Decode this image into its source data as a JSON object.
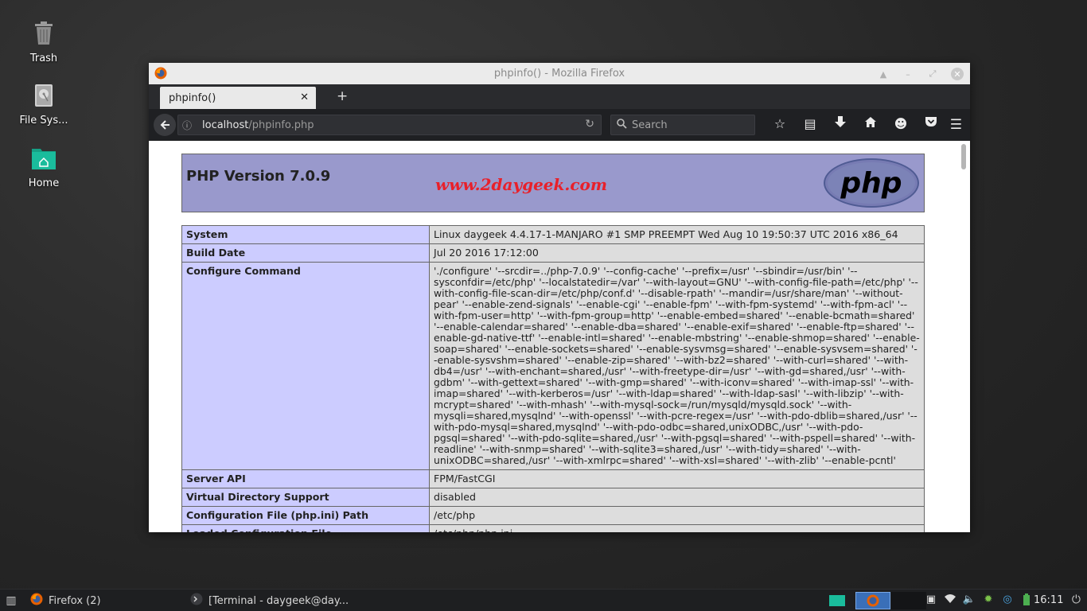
{
  "desktop": {
    "icons": [
      {
        "label": "Trash"
      },
      {
        "label": "File Sys..."
      },
      {
        "label": "Home"
      }
    ]
  },
  "window": {
    "title": "phpinfo() - Mozilla Firefox"
  },
  "browser": {
    "tab_title": "phpinfo()",
    "url_host": "localhost",
    "url_path": "/phpinfo.php",
    "search_placeholder": "Search"
  },
  "page": {
    "heading": "PHP Version 7.0.9",
    "watermark": "www.2daygeek.com",
    "logo_text": "php",
    "rows": [
      {
        "key": "System",
        "value": "Linux daygeek 4.4.17-1-MANJARO #1 SMP PREEMPT Wed Aug 10 19:50:37 UTC 2016 x86_64"
      },
      {
        "key": "Build Date",
        "value": "Jul 20 2016 17:12:00"
      },
      {
        "key": "Configure Command",
        "value": "'./configure' '--srcdir=../php-7.0.9' '--config-cache' '--prefix=/usr' '--sbindir=/usr/bin' '--sysconfdir=/etc/php' '--localstatedir=/var' '--with-layout=GNU' '--with-config-file-path=/etc/php' '--with-config-file-scan-dir=/etc/php/conf.d' '--disable-rpath' '--mandir=/usr/share/man' '--without-pear' '--enable-zend-signals' '--enable-cgi' '--enable-fpm' '--with-fpm-systemd' '--with-fpm-acl' '--with-fpm-user=http' '--with-fpm-group=http' '--enable-embed=shared' '--enable-bcmath=shared' '--enable-calendar=shared' '--enable-dba=shared' '--enable-exif=shared' '--enable-ftp=shared' '--enable-gd-native-ttf' '--enable-intl=shared' '--enable-mbstring' '--enable-shmop=shared' '--enable-soap=shared' '--enable-sockets=shared' '--enable-sysvmsg=shared' '--enable-sysvsem=shared' '--enable-sysvshm=shared' '--enable-zip=shared' '--with-bz2=shared' '--with-curl=shared' '--with-db4=/usr' '--with-enchant=shared,/usr' '--with-freetype-dir=/usr' '--with-gd=shared,/usr' '--with-gdbm' '--with-gettext=shared' '--with-gmp=shared' '--with-iconv=shared' '--with-imap-ssl' '--with-imap=shared' '--with-kerberos=/usr' '--with-ldap=shared' '--with-ldap-sasl' '--with-libzip' '--with-mcrypt=shared' '--with-mhash' '--with-mysql-sock=/run/mysqld/mysqld.sock' '--with-mysqli=shared,mysqlnd' '--with-openssl' '--with-pcre-regex=/usr' '--with-pdo-dblib=shared,/usr' '--with-pdo-mysql=shared,mysqlnd' '--with-pdo-odbc=shared,unixODBC,/usr' '--with-pdo-pgsql=shared' '--with-pdo-sqlite=shared,/usr' '--with-pgsql=shared' '--with-pspell=shared' '--with-readline' '--with-snmp=shared' '--with-sqlite3=shared,/usr' '--with-tidy=shared' '--with-unixODBC=shared,/usr' '--with-xmlrpc=shared' '--with-xsl=shared' '--with-zlib' '--enable-pcntl'"
      },
      {
        "key": "Server API",
        "value": "FPM/FastCGI"
      },
      {
        "key": "Virtual Directory Support",
        "value": "disabled"
      },
      {
        "key": "Configuration File (php.ini) Path",
        "value": "/etc/php"
      },
      {
        "key": "Loaded Configuration File",
        "value": "/etc/php/php.ini"
      }
    ]
  },
  "taskbar": {
    "tasks": [
      {
        "label": "Firefox (2)"
      },
      {
        "label": "[Terminal - daygeek@day..."
      }
    ],
    "clock": "16:11"
  },
  "colors": {
    "php_header": "#9999cc",
    "key_cell": "#ccccff",
    "value_cell": "#dddddd",
    "watermark": "#e8202a",
    "home_folder": "#1abc9c"
  }
}
